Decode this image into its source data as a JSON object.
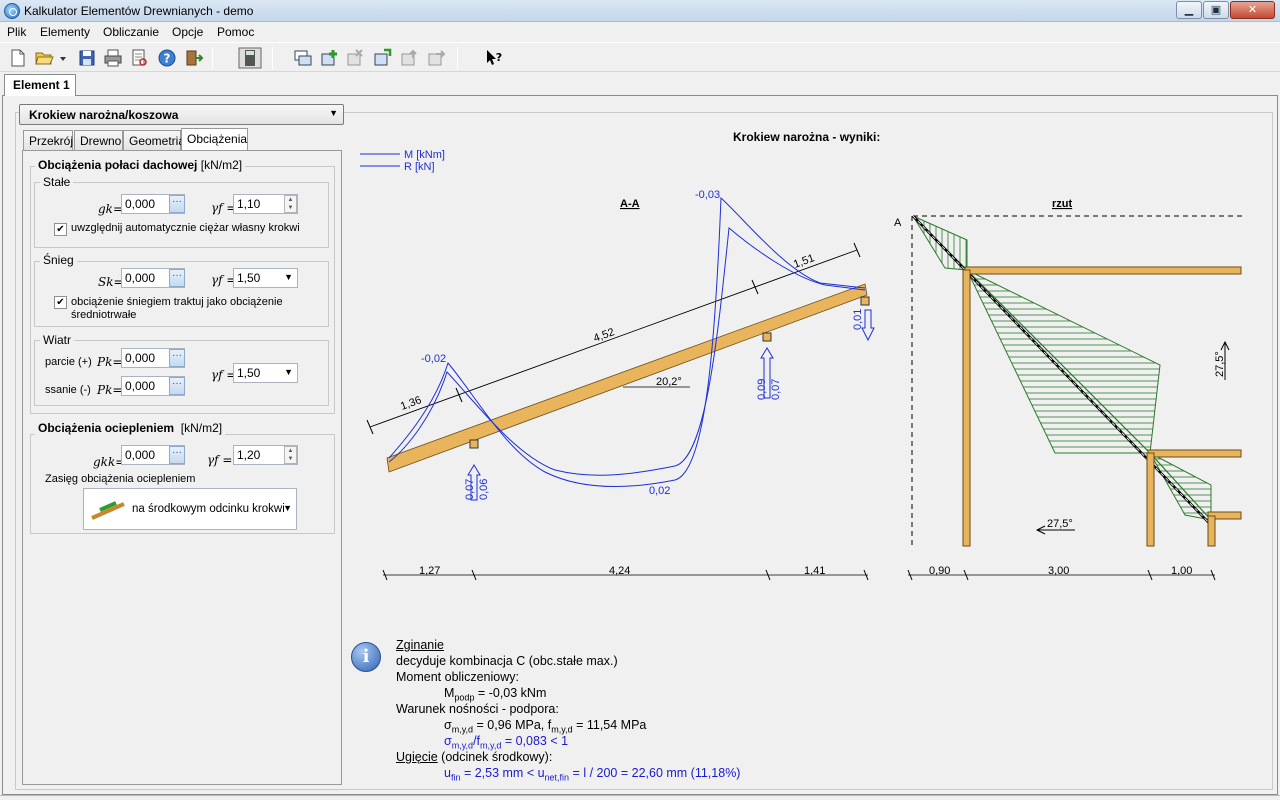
{
  "window": {
    "title": "Kalkulator Elementów Drewnianych - demo"
  },
  "menu": [
    "Plik",
    "Elementy",
    "Obliczanie",
    "Opcje",
    "Pomoc"
  ],
  "element_tab": "Element 1",
  "element_type": "Krokiew narożna/koszowa",
  "subtabs": [
    "Przekrój",
    "Drewno",
    "Geometria",
    "Obciążenia"
  ],
  "roof_loads": {
    "title": "Obciążenia połaci dachowej",
    "unit": "[kN/m2]",
    "permanent": {
      "title": "Stałe",
      "gk_label": "gk=",
      "gk_value": "0,000",
      "gf_label": "γf =",
      "gf_value": "1,10",
      "checkbox_label": "uwzględnij automatycznie ciężar  własny krokwi"
    },
    "snow": {
      "title": "Śnieg",
      "sk_label": "Sk=",
      "sk_value": "0,000",
      "gf_label": "γf =",
      "gf_value": "1,50",
      "checkbox_label_1": "obciążenie śniegiem traktuj jako obciążenie",
      "checkbox_label_2": "średniotrwałe"
    },
    "wind": {
      "title": "Wiatr",
      "pressure_label": "parcie (+)",
      "suction_label": "ssanie (-)",
      "pk_label": "Pk=",
      "pressure_value": "0,000",
      "suction_value": "0,000",
      "gf_label": "γf =",
      "gf_value": "1,50"
    }
  },
  "insulation": {
    "title": "Obciążenia ociepleniem",
    "unit": "[kN/m2]",
    "gkk_label": "gkk=",
    "gkk_value": "0,000",
    "gf_label": "γf =",
    "gf_value": "1,20",
    "range_label": "Zasięg obciążenia ociepleniem",
    "range_value": "na środkowym odcinku krokwi"
  },
  "diagram": {
    "title": "Krokiew narożna - wyniki:",
    "legend_m": "M [kNm]",
    "legend_r": "R [kN]",
    "section_label": "A-A",
    "plan_label": "rzut",
    "angle": "20,2°",
    "lengths": [
      "1,36",
      "4,52",
      "1,51"
    ],
    "moment_labels": [
      "-0,02",
      "0,02",
      "-0,03"
    ],
    "reactions": [
      [
        "0,07",
        "0,06"
      ],
      [
        "0,09",
        "0,07"
      ],
      [
        "0,01"
      ]
    ],
    "spans": [
      "1,27",
      "4,24",
      "1,41"
    ],
    "plan_spans": [
      "0,90",
      "3,00",
      "1,00"
    ],
    "plan_angle_v": "27,5°",
    "plan_angle_h": "27,5°",
    "section_mark": "A"
  },
  "results": {
    "heading": "Zginanie",
    "line1": "decyduje kombinacja C (obc.stałe max.)",
    "line2": "Moment obliczeniowy:",
    "moment_sym": "M",
    "moment_sub": "podp",
    "moment_val": " = -0,03 kNm",
    "line4": "Warunek nośności - podpora:",
    "sigma_sym": "σ",
    "sigma_sub": "m,y,d",
    "sigma_val": " = 0,96 MPa,  ",
    "f_sym": "f",
    "f_sub": "m,y,d",
    "f_val": " = 11,54 MPa",
    "ratio_sym": "σ",
    "ratio_sub1": "m,y,d",
    "ratio_mid": "/f",
    "ratio_sub2": "m,y,d",
    "ratio_val": " = 0,083  <  1",
    "deflection_heading": "Ugięcie",
    "deflection_note": " (odcinek środkowy):",
    "u_sym": "u",
    "u_sub": "fin",
    "u_val": " = 2,53 mm  <   ",
    "unet_sym": "u",
    "unet_sub": "net,fin",
    "unet_val": " = l / 200 = 22,60 mm     (11,18%)"
  },
  "colors": {
    "beam": "#e8b55d",
    "diagram_line": "#1d2fd6",
    "hatch": "#2c7a2c",
    "result_blue": "#1a1ad0"
  }
}
